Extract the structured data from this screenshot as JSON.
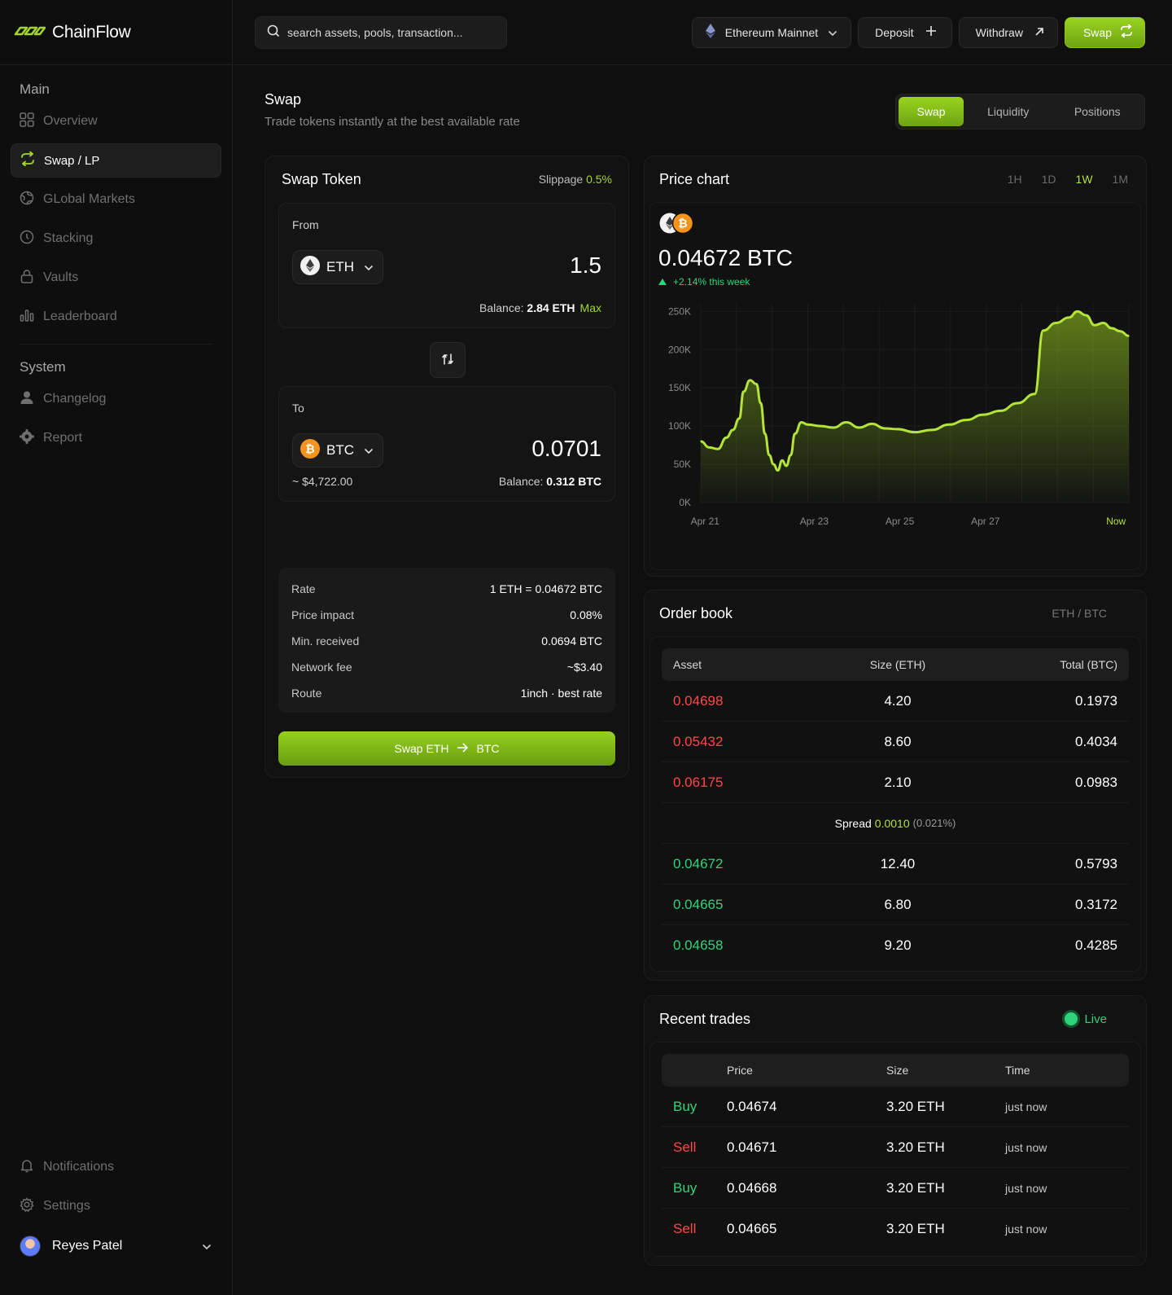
{
  "brand": {
    "name": "ChainFlow"
  },
  "colors": {
    "accent": "#9ad321",
    "positive": "#2fd47a",
    "negative": "#ff4747",
    "background": "#0f0f0f"
  },
  "sidebar": {
    "main_title": "Main",
    "main_items": [
      {
        "label": "Overview",
        "icon": "grid-icon",
        "active": false
      },
      {
        "label": "Swap / LP",
        "icon": "swap-arrows-icon",
        "active": true
      },
      {
        "label": "GLobal Markets",
        "icon": "globe-icon",
        "active": false
      },
      {
        "label": "Stacking",
        "icon": "clock-coin-icon",
        "active": false
      },
      {
        "label": "Vaults",
        "icon": "lock-icon",
        "active": false
      },
      {
        "label": "Leaderboard",
        "icon": "bar-chart-icon",
        "active": false
      }
    ],
    "system_title": "System",
    "system_items": [
      {
        "label": "Changelog",
        "icon": "user-icon"
      },
      {
        "label": "Report",
        "icon": "cog-icon"
      }
    ],
    "bottom_items": [
      {
        "label": "Notifications",
        "icon": "bell-icon"
      },
      {
        "label": "Settings",
        "icon": "settings-icon"
      }
    ],
    "user_name": "Reyes Patel"
  },
  "topbar": {
    "search_placeholder": "search assets, pools, transaction...",
    "network": "Ethereum Mainnet",
    "deposit": "Deposit",
    "withdraw": "Withdraw",
    "swap": "Swap"
  },
  "page": {
    "title": "Swap",
    "subtitle": "Trade tokens instantly at the best available rate",
    "tabs": [
      "Swap",
      "Liquidity",
      "Positions"
    ],
    "active_tab": "Swap"
  },
  "swap": {
    "title": "Swap Token",
    "slippage_label": "Slippage",
    "slippage_value": "0.5%",
    "from_label": "From",
    "from_token": "ETH",
    "from_amount": "1.5",
    "from_balance_label": "Balance:",
    "from_balance": "2.84 ETH",
    "max_label": "Max",
    "to_label": "To",
    "to_token": "BTC",
    "to_amount": "0.0701",
    "to_usd": "~ $4,722.00",
    "to_balance_label": "Balance:",
    "to_balance": "0.312 BTC",
    "details": [
      {
        "key": "Rate",
        "value": "1 ETH = 0.04672 BTC"
      },
      {
        "key": "Price impact",
        "value": "0.08%"
      },
      {
        "key": "Min. received",
        "value": "0.0694 BTC"
      },
      {
        "key": "Network fee",
        "value": "~$3.40"
      },
      {
        "key": "Route",
        "value": "1inch · best rate"
      }
    ],
    "cta_from": "Swap ETH",
    "cta_to": "BTC"
  },
  "price_chart": {
    "title": "Price chart",
    "timeframes": [
      "1H",
      "1D",
      "1W",
      "1M"
    ],
    "active_timeframe": "1W",
    "price": "0.04672 BTC",
    "change": "+2.14% this week"
  },
  "chart_data": {
    "type": "area",
    "x_tick_labels": [
      "Apr 21",
      "Apr 23",
      "Apr 25",
      "Apr 27",
      "Now"
    ],
    "y_tick_labels": [
      "250K",
      "200K",
      "150K",
      "100K",
      "50K",
      "0K"
    ],
    "ylim": [
      0,
      260000
    ],
    "grid": true,
    "x": [
      0,
      0.02,
      0.04,
      0.06,
      0.075,
      0.09,
      0.1,
      0.115,
      0.13,
      0.14,
      0.15,
      0.16,
      0.17,
      0.18,
      0.19,
      0.2,
      0.21,
      0.22,
      0.235,
      0.25,
      0.28,
      0.31,
      0.34,
      0.37,
      0.4,
      0.43,
      0.46,
      0.5,
      0.54,
      0.58,
      0.62,
      0.66,
      0.7,
      0.74,
      0.78,
      0.8,
      0.83,
      0.86,
      0.88,
      0.9,
      0.92,
      0.94,
      0.96,
      0.98,
      1.0
    ],
    "values": [
      80000,
      72000,
      70000,
      85000,
      95000,
      110000,
      145000,
      160000,
      155000,
      130000,
      90000,
      62000,
      50000,
      42000,
      55000,
      48000,
      62000,
      90000,
      105000,
      102000,
      100000,
      98000,
      105000,
      98000,
      103000,
      97000,
      96000,
      92000,
      95000,
      102000,
      108000,
      115000,
      120000,
      130000,
      142000,
      225000,
      235000,
      242000,
      250000,
      245000,
      232000,
      235000,
      228000,
      224000,
      218000
    ],
    "series": [
      {
        "name": "ETH/BTC",
        "color": "#b4e43a"
      }
    ]
  },
  "order_book": {
    "title": "Order book",
    "pair": "ETH / BTC",
    "columns": [
      "Asset",
      "Size (ETH)",
      "Total (BTC)"
    ],
    "asks": [
      {
        "price": "0.04698",
        "size": "4.20",
        "total": "0.1973"
      },
      {
        "price": "0.05432",
        "size": "8.60",
        "total": "0.4034"
      },
      {
        "price": "0.06175",
        "size": "2.10",
        "total": "0.0983"
      }
    ],
    "spread_label": "Spread",
    "spread_value": "0.0010",
    "spread_pct": "(0.021%)",
    "bids": [
      {
        "price": "0.04672",
        "size": "12.40",
        "total": "0.5793"
      },
      {
        "price": "0.04665",
        "size": "6.80",
        "total": "0.3172"
      },
      {
        "price": "0.04658",
        "size": "9.20",
        "total": "0.4285"
      }
    ]
  },
  "recent_trades": {
    "title": "Recent trades",
    "live_label": "Live",
    "columns": [
      "",
      "Price",
      "Size",
      "Time"
    ],
    "rows": [
      {
        "side": "Buy",
        "price": "0.04674",
        "size": "3.20 ETH",
        "time": "just now"
      },
      {
        "side": "Sell",
        "price": "0.04671",
        "size": "3.20 ETH",
        "time": "just now"
      },
      {
        "side": "Buy",
        "price": "0.04668",
        "size": "3.20 ETH",
        "time": "just now"
      },
      {
        "side": "Sell",
        "price": "0.04665",
        "size": "3.20 ETH",
        "time": "just now"
      }
    ]
  }
}
